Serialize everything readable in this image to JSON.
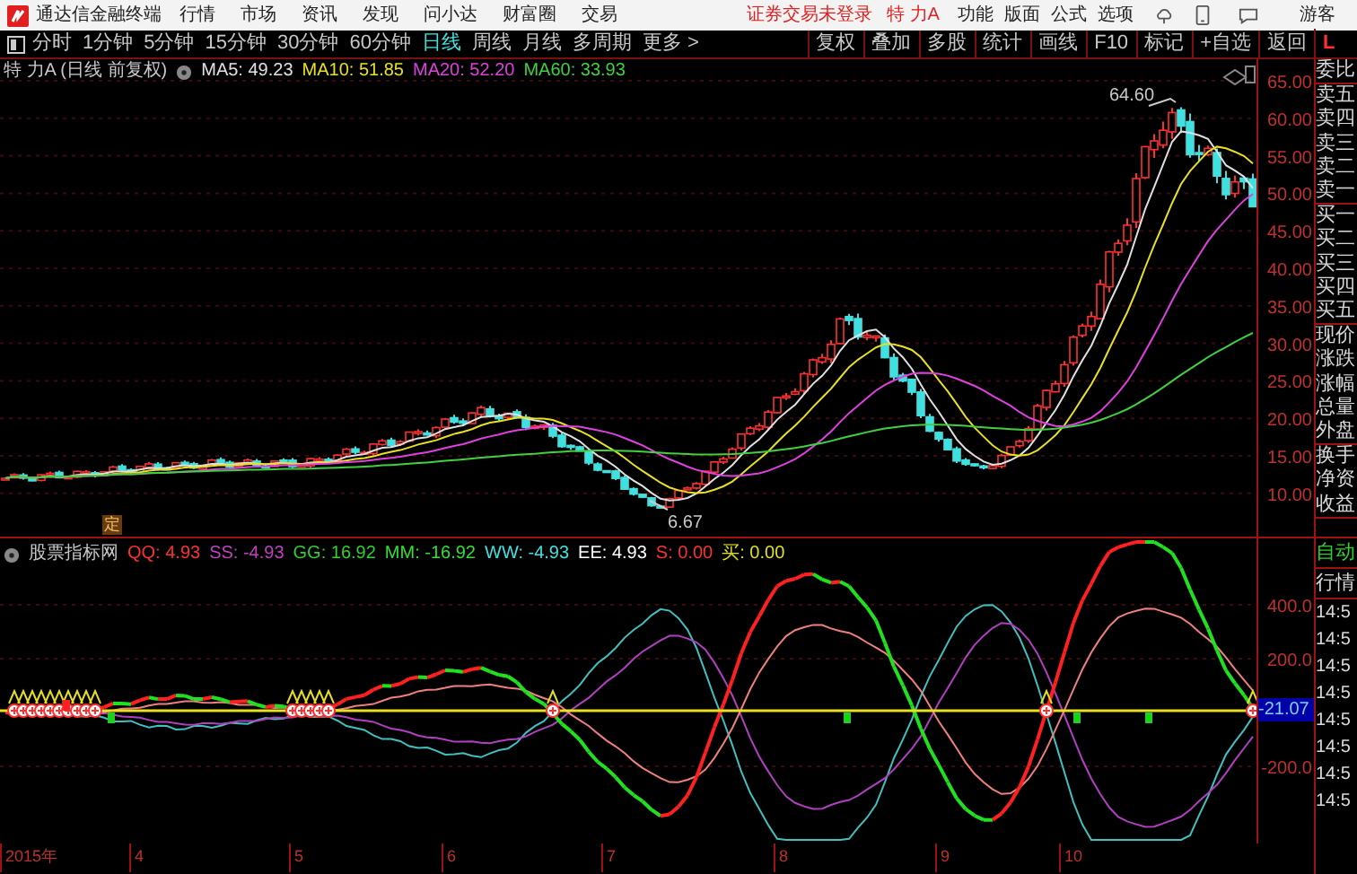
{
  "title_bar": {
    "app_name": "通达信金融终端",
    "menus": [
      "行情",
      "市场",
      "资讯",
      "发现",
      "问小达",
      "财富圈",
      "交易"
    ],
    "login_status": "证券交易未登录",
    "stock_name": "特 力A",
    "right_menus": [
      "功能",
      "版面",
      "公式",
      "选项"
    ],
    "user": "游客"
  },
  "period_tabs": [
    {
      "label": "分时",
      "selected": false
    },
    {
      "label": "1分钟",
      "selected": false
    },
    {
      "label": "5分钟",
      "selected": false
    },
    {
      "label": "15分钟",
      "selected": false
    },
    {
      "label": "30分钟",
      "selected": false
    },
    {
      "label": "60分钟",
      "selected": false
    },
    {
      "label": "日线",
      "selected": true
    },
    {
      "label": "周线",
      "selected": false
    },
    {
      "label": "月线",
      "selected": false
    },
    {
      "label": "多周期",
      "selected": false
    },
    {
      "label": "更多 >",
      "selected": false
    }
  ],
  "tools": [
    "复权",
    "叠加",
    "多股",
    "统计",
    "画线",
    "F10",
    "标记",
    "+自选",
    "返回"
  ],
  "corner": "L",
  "price_chart": {
    "title": "特 力A (日线 前复权)",
    "ma": [
      {
        "label": "MA5: 49.23",
        "color": "#e0e0e0"
      },
      {
        "label": "MA10: 51.85",
        "color": "#e8e020"
      },
      {
        "label": "MA20: 52.20",
        "color": "#e040e0"
      },
      {
        "label": "MA60: 33.93",
        "color": "#40d040"
      }
    ],
    "y_labels": [
      "65.00",
      "60.00",
      "55.00",
      "50.00",
      "45.00",
      "40.00",
      "35.00",
      "30.00",
      "25.00",
      "20.00",
      "15.00",
      "10.00"
    ],
    "high_label": "64.60",
    "low_label": "6.67",
    "marker": "定"
  },
  "indicator": {
    "name": "股票指标网",
    "values": [
      {
        "label": "QQ: 4.93",
        "color": "#ff3030"
      },
      {
        "label": "SS: -4.93",
        "color": "#c040c0"
      },
      {
        "label": "GG: 16.92",
        "color": "#30d030"
      },
      {
        "label": "MM: -16.92",
        "color": "#30e030"
      },
      {
        "label": "WW: -4.93",
        "color": "#40e0e0"
      },
      {
        "label": "EE: 4.93",
        "color": "#ffffff"
      },
      {
        "label": "S: 0.00",
        "color": "#ff3030"
      },
      {
        "label": "买: 0.00",
        "color": "#e0e020"
      }
    ],
    "y_labels": [
      "400.0",
      "200.0",
      "-200.0"
    ],
    "current": "-21.07"
  },
  "x_axis": [
    "2015年",
    "4",
    "5",
    "6",
    "7",
    "8",
    "9",
    "10"
  ],
  "side_panel": {
    "quote_groups": [
      [
        "委比"
      ],
      [
        "卖五",
        "卖四",
        "卖三",
        "卖二",
        "卖一"
      ],
      [
        "买一",
        "买二",
        "买三",
        "买四",
        "买五"
      ],
      [
        "现价",
        "涨跌",
        "涨幅",
        "总量",
        "外盘"
      ],
      [
        "换手",
        "净资",
        "收益"
      ]
    ],
    "tabs": [
      "自动",
      "行情"
    ],
    "times": [
      "14:5",
      "14:5",
      "14:5",
      "14:5",
      "14:5",
      "14:5",
      "14:5",
      "14:5"
    ]
  }
}
